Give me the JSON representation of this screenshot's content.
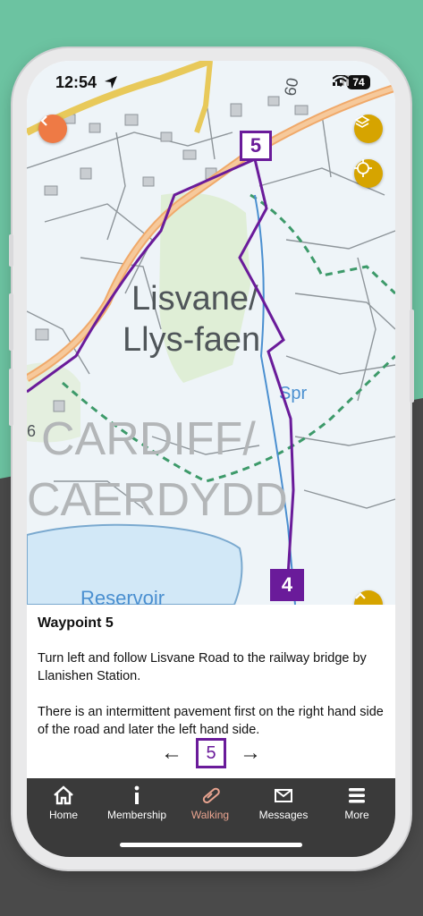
{
  "status_bar": {
    "time": "12:54",
    "battery": "74"
  },
  "map": {
    "labels": {
      "place_1": "Lisvane/",
      "place_2": "Llys-faen",
      "city_1": "CARDIFF/",
      "city_2": "CAERDYDD",
      "water": "Reservoir",
      "spring": "Spr",
      "road": "60",
      "edge_num": "6"
    },
    "current_waypoint_marker": "5",
    "previous_waypoint_marker": "4",
    "route_color": "#6a1b9a"
  },
  "panel": {
    "title": "Waypoint 5",
    "paragraph_1": "Turn left and follow Lisvane Road to the railway bridge by Llanishen Station.",
    "paragraph_2": "There is an intermittent pavement first on the right hand side of the road and later the left hand side.",
    "page_number": "5",
    "prev_arrow": "←",
    "next_arrow": "→"
  },
  "tabs": [
    {
      "label": "Home",
      "icon": "home-icon"
    },
    {
      "label": "Membership",
      "icon": "info-icon"
    },
    {
      "label": "Walking",
      "icon": "boot-icon",
      "active": true
    },
    {
      "label": "Messages",
      "icon": "mail-icon"
    },
    {
      "label": "More",
      "icon": "menu-icon"
    }
  ],
  "colors": {
    "accent_orange": "#ee7a45",
    "map_button_yellow": "#d6a400",
    "tabbar_bg": "#3a3a3a",
    "active_tab": "#e8a38f",
    "background_green": "#6cc3a1"
  }
}
